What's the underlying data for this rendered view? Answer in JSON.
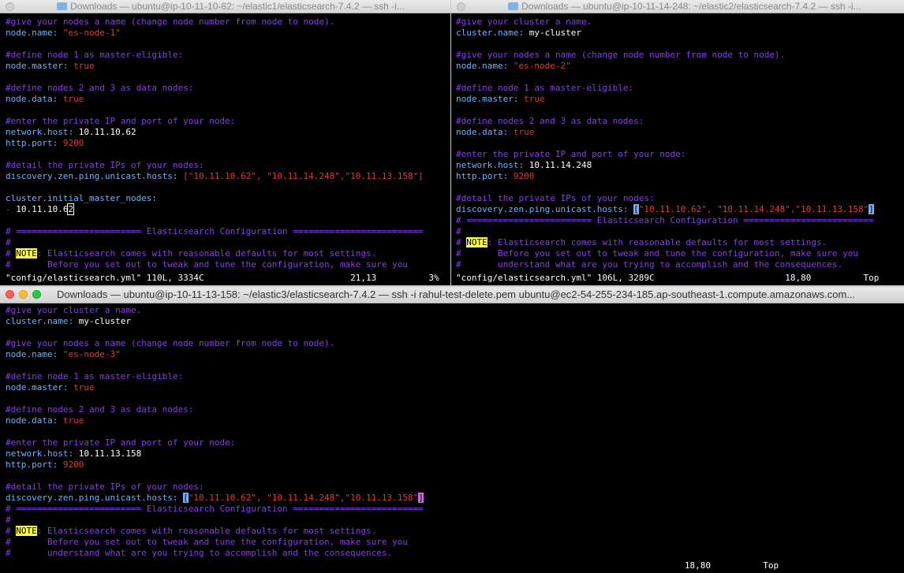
{
  "windows": [
    {
      "title": "Downloads — ubuntu@ip-10-11-10-62: ~/elastic1/elasticsearch-7.4.2 — ssh -i...",
      "lines": [
        [
          [
            "c",
            "#give your nodes a name (change node number from node to node).",
            ""
          ]
        ],
        [
          [
            "k",
            "node.name:",
            ""
          ],
          [
            "w",
            " ",
            ""
          ],
          [
            "s",
            "\"es-node-1\"",
            ""
          ]
        ],
        [
          [
            "w",
            "",
            ""
          ]
        ],
        [
          [
            "c",
            "#define node 1 as master-eligible:",
            ""
          ]
        ],
        [
          [
            "k",
            "node.master:",
            ""
          ],
          [
            "w",
            " ",
            ""
          ],
          [
            "s",
            "true",
            ""
          ]
        ],
        [
          [
            "w",
            "",
            ""
          ]
        ],
        [
          [
            "c",
            "#define nodes 2 and 3 as data nodes:",
            ""
          ]
        ],
        [
          [
            "k",
            "node.data:",
            ""
          ],
          [
            "w",
            " ",
            ""
          ],
          [
            "s",
            "true",
            ""
          ]
        ],
        [
          [
            "w",
            "",
            ""
          ]
        ],
        [
          [
            "c",
            "#enter the private IP and port of your node:",
            ""
          ]
        ],
        [
          [
            "k",
            "network.host:",
            ""
          ],
          [
            "w",
            " 10.11.10.62",
            ""
          ]
        ],
        [
          [
            "k",
            "http.port:",
            ""
          ],
          [
            "w",
            " ",
            ""
          ],
          [
            "s",
            "9200",
            ""
          ]
        ],
        [
          [
            "w",
            "",
            ""
          ]
        ],
        [
          [
            "c",
            "#detail the private IPs of your nodes:",
            ""
          ]
        ],
        [
          [
            "k",
            "discovery.zen.ping.unicast.hosts:",
            ""
          ],
          [
            "w",
            " ",
            ""
          ],
          [
            "s",
            "[\"10.11.10.62\", \"10.11.14.248\",\"10.11.13.158\"]",
            ""
          ]
        ],
        [
          [
            "w",
            "",
            ""
          ]
        ],
        [
          [
            "k",
            "cluster.initial_master_nodes:",
            ""
          ]
        ],
        [
          [
            "s",
            "-",
            ""
          ],
          [
            "w",
            " 10.11.10.6",
            ""
          ],
          [
            "w",
            "2",
            "curw"
          ]
        ],
        [
          [
            "w",
            "",
            ""
          ]
        ],
        [
          [
            "c",
            "# ======================== Elasticsearch Configuration =========================",
            ""
          ]
        ],
        [
          [
            "c",
            "#",
            ""
          ]
        ],
        [
          [
            "c",
            "# ",
            ""
          ],
          [
            "w",
            "NOTE",
            "note"
          ],
          [
            "c",
            ": Elasticsearch comes with reasonable defaults for most settings.",
            ""
          ]
        ],
        [
          [
            "c",
            "#       Before you set out to tweak and tune the configuration, make sure you",
            ""
          ]
        ]
      ],
      "status": "\"config/elasticsearch.yml\" 110L, 3334C                            21,13          3%"
    },
    {
      "title": "Downloads — ubuntu@ip-10-11-14-248: ~/elastic2/elasticsearch-7.4.2 — ssh -i...",
      "lines": [
        [
          [
            "c",
            "#give your cluster a name.",
            ""
          ]
        ],
        [
          [
            "k",
            "cluster.name:",
            ""
          ],
          [
            "w",
            " my-cluster",
            ""
          ]
        ],
        [
          [
            "w",
            "",
            ""
          ]
        ],
        [
          [
            "c",
            "#give your nodes a name (change node number from node to node).",
            ""
          ]
        ],
        [
          [
            "k",
            "node.name:",
            ""
          ],
          [
            "w",
            " ",
            ""
          ],
          [
            "s",
            "\"es-node-2\"",
            ""
          ]
        ],
        [
          [
            "w",
            "",
            ""
          ]
        ],
        [
          [
            "c",
            "#define node 1 as master-eligible:",
            ""
          ]
        ],
        [
          [
            "k",
            "node.master:",
            ""
          ],
          [
            "w",
            " ",
            ""
          ],
          [
            "s",
            "true",
            ""
          ]
        ],
        [
          [
            "w",
            "",
            ""
          ]
        ],
        [
          [
            "c",
            "#define nodes 2 and 3 as data nodes:",
            ""
          ]
        ],
        [
          [
            "k",
            "node.data:",
            ""
          ],
          [
            "w",
            " ",
            ""
          ],
          [
            "s",
            "true",
            ""
          ]
        ],
        [
          [
            "w",
            "",
            ""
          ]
        ],
        [
          [
            "c",
            "#enter the private IP and port of your node:",
            ""
          ]
        ],
        [
          [
            "k",
            "network.host:",
            ""
          ],
          [
            "w",
            " 10.11.14.248",
            ""
          ]
        ],
        [
          [
            "k",
            "http.port:",
            ""
          ],
          [
            "w",
            " ",
            ""
          ],
          [
            "s",
            "9200",
            ""
          ]
        ],
        [
          [
            "w",
            "",
            ""
          ]
        ],
        [
          [
            "c",
            "#detail the private IPs of your nodes:",
            ""
          ]
        ],
        [
          [
            "k",
            "discovery.zen.ping.unicast.hosts:",
            ""
          ],
          [
            "w",
            " ",
            ""
          ],
          [
            "s",
            "[",
            "cur"
          ],
          [
            "s",
            "\"10.11.10.62\", \"10.11.14.248\",\"10.11.13.158\"",
            ""
          ],
          [
            "s",
            "]",
            "cur"
          ]
        ],
        [
          [
            "c",
            "# ======================== Elasticsearch Configuration =========================",
            ""
          ]
        ],
        [
          [
            "c",
            "#",
            ""
          ]
        ],
        [
          [
            "c",
            "# ",
            ""
          ],
          [
            "w",
            "NOTE",
            "note"
          ],
          [
            "c",
            ": Elasticsearch comes with reasonable defaults for most settings.",
            ""
          ]
        ],
        [
          [
            "c",
            "#       Before you set out to tweak and tune the configuration, make sure you",
            ""
          ]
        ],
        [
          [
            "c",
            "#       understand what are you trying to accomplish and the consequences.",
            ""
          ]
        ]
      ],
      "status": "\"config/elasticsearch.yml\" 106L, 3289C                         18,80          Top"
    },
    {
      "title": "Downloads — ubuntu@ip-10-11-13-158: ~/elastic3/elasticsearch-7.4.2 — ssh -i rahul-test-delete.pem ubuntu@ec2-54-255-234-185.ap-southeast-1.compute.amazonaws.com...",
      "lines": [
        [
          [
            "c",
            "#give your cluster a name.",
            ""
          ]
        ],
        [
          [
            "k",
            "cluster.name:",
            ""
          ],
          [
            "w",
            " my-cluster",
            ""
          ]
        ],
        [
          [
            "w",
            "",
            ""
          ]
        ],
        [
          [
            "c",
            "#give your nodes a name (change node number from node to node).",
            ""
          ]
        ],
        [
          [
            "k",
            "node.name:",
            ""
          ],
          [
            "w",
            " ",
            ""
          ],
          [
            "s",
            "\"es-node-3\"",
            ""
          ]
        ],
        [
          [
            "w",
            "",
            ""
          ]
        ],
        [
          [
            "c",
            "#define node 1 as master-eligible:",
            ""
          ]
        ],
        [
          [
            "k",
            "node.master:",
            ""
          ],
          [
            "w",
            " ",
            ""
          ],
          [
            "s",
            "true",
            ""
          ]
        ],
        [
          [
            "w",
            "",
            ""
          ]
        ],
        [
          [
            "c",
            "#define nodes 2 and 3 as data nodes:",
            ""
          ]
        ],
        [
          [
            "k",
            "node.data:",
            ""
          ],
          [
            "w",
            " ",
            ""
          ],
          [
            "s",
            "true",
            ""
          ]
        ],
        [
          [
            "w",
            "",
            ""
          ]
        ],
        [
          [
            "c",
            "#enter the private IP and port of your node:",
            ""
          ]
        ],
        [
          [
            "k",
            "network.host:",
            ""
          ],
          [
            "w",
            " 10.11.13.158",
            ""
          ]
        ],
        [
          [
            "k",
            "http.port:",
            ""
          ],
          [
            "w",
            " ",
            ""
          ],
          [
            "s",
            "9200",
            ""
          ]
        ],
        [
          [
            "w",
            "",
            ""
          ]
        ],
        [
          [
            "c",
            "#detail the private IPs of your nodes:",
            ""
          ]
        ],
        [
          [
            "k",
            "discovery.zen.ping.unicast.hosts:",
            ""
          ],
          [
            "w",
            " ",
            ""
          ],
          [
            "s",
            "[",
            "cur"
          ],
          [
            "s",
            "\"10.11.10.62\", \"10.11.14.248\",\"10.11.13.158\"",
            ""
          ],
          [
            "s",
            "]",
            "curp"
          ]
        ],
        [
          [
            "c",
            "# ======================== Elasticsearch Configuration =========================",
            ""
          ]
        ],
        [
          [
            "c",
            "#",
            ""
          ]
        ],
        [
          [
            "c",
            "# ",
            ""
          ],
          [
            "w",
            "NOTE",
            "note"
          ],
          [
            "c",
            ": Elasticsearch comes with reasonable defaults for most settings.",
            ""
          ]
        ],
        [
          [
            "c",
            "#       Before you set out to tweak and tune the configuration, make sure you",
            ""
          ]
        ],
        [
          [
            "c",
            "#       understand what are you trying to accomplish and the consequences.",
            ""
          ]
        ]
      ],
      "status": "                                                                                                                                  18,80          Top"
    }
  ]
}
